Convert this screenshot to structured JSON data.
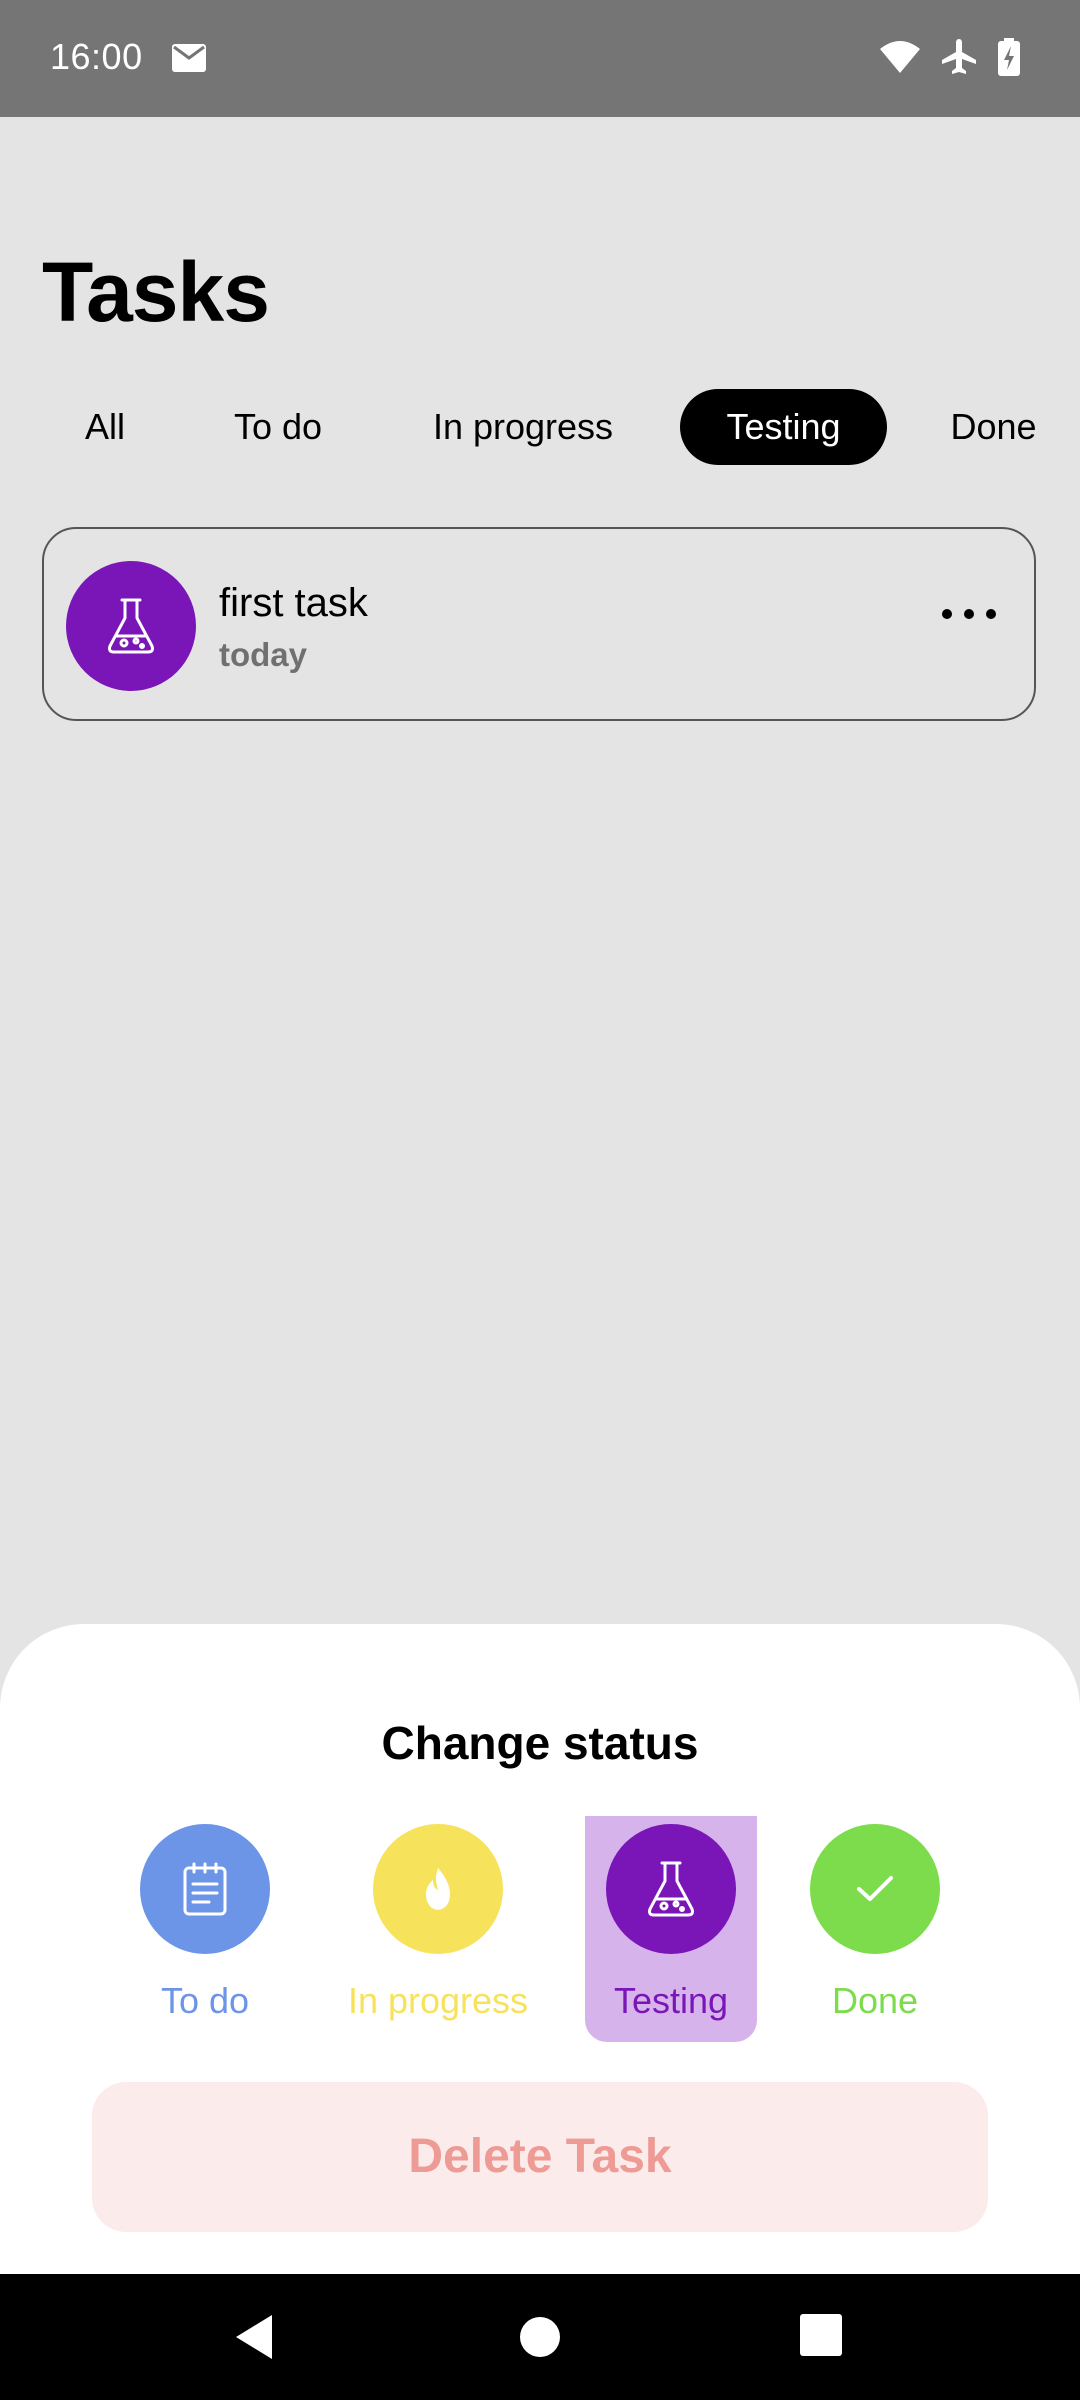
{
  "status_bar": {
    "time": "16:00",
    "icons": [
      "mail-icon",
      "wifi-icon",
      "airplane-icon",
      "battery-charging-icon"
    ]
  },
  "page": {
    "title": "Tasks"
  },
  "tabs": [
    {
      "label": "All",
      "active": false
    },
    {
      "label": "To do",
      "active": false
    },
    {
      "label": "In progress",
      "active": false
    },
    {
      "label": "Testing",
      "active": true
    },
    {
      "label": "Done",
      "active": false
    }
  ],
  "tasks": [
    {
      "title": "first task",
      "date": "today",
      "icon": "flask-icon",
      "icon_color": "#7a16b8"
    }
  ],
  "sheet": {
    "title": "Change status",
    "options": [
      {
        "label": "To do",
        "icon": "notepad-icon",
        "color": "#6c95e8",
        "selected": false
      },
      {
        "label": "In progress",
        "icon": "flame-icon",
        "color": "#f7e25b",
        "selected": false
      },
      {
        "label": "Testing",
        "icon": "flask-icon",
        "color": "#7a16b8",
        "selected": true
      },
      {
        "label": "Done",
        "icon": "check-icon",
        "color": "#7ddc4b",
        "selected": false
      }
    ],
    "delete_label": "Delete Task"
  },
  "nav": {
    "icons": [
      "back-icon",
      "home-icon",
      "recents-icon"
    ]
  }
}
